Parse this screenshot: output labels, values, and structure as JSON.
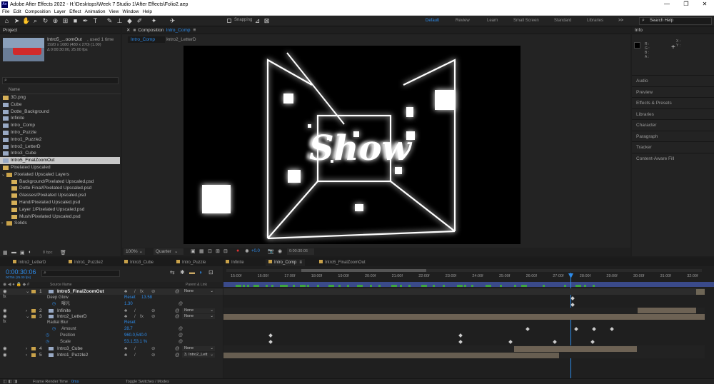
{
  "app": {
    "title": "Adobe After Effects 2022 - H:\\Desktops\\Week 7 Studio 1\\After Effects\\Folio2.aep",
    "icon_text": "Ae"
  },
  "menu": [
    "File",
    "Edit",
    "Composition",
    "Layer",
    "Effect",
    "Animation",
    "View",
    "Window",
    "Help"
  ],
  "toolbar": {
    "snapping_label": "Snapping",
    "search_placeholder": "Search Help",
    "more_label": ">>"
  },
  "workspaces": [
    "Default",
    "Review",
    "Learn",
    "Small Screen",
    "Standard",
    "Libraries"
  ],
  "project": {
    "tab": "Project",
    "selected_name": "Intro5_...oomOut",
    "selected_used": ", used 1 time",
    "selected_info1": "1920 x 1080 (480 x 270) (1.00)",
    "selected_info2": "Δ 0:00:30:00, 25.00 fps",
    "search_placeholder": "",
    "column_name": "Name",
    "items": [
      "3D.png",
      "Cube",
      "Dotte_Background",
      "Infinite",
      "Intro_Comp",
      "Intro_Puzzle",
      "Intro1_Puzzle2",
      "Intro2_LetterD",
      "Intro3_Cube",
      "Intro5_FinalZoomOut",
      "Pixelated Upscaled",
      "Pixelated Upscaled Layers",
      "Background/Pixelated Upscaled.psd",
      "Dotte Final/Pixelated Upscaled.psd",
      "Glasses/Pixelated Upscaled.psd",
      "Hand/Pixelated Upscaled.psd",
      "Layer 1/Pixelated Upscaled.psd",
      "Mush/Pixelated Upscaled.psd",
      "Solids"
    ],
    "bpc": "8 bpc"
  },
  "composition": {
    "tab_prefix": "Composition",
    "tab_name": "Intro_Comp",
    "menu_icon": "≡",
    "breadcrumbs": [
      "Intro_Comp",
      "Intro2_LetterD"
    ],
    "viewer_text": "Show",
    "zoom": "100%",
    "resolution": "Quarter",
    "exposure": "+0.0",
    "timecode": "0:00:30:06"
  },
  "right_panel": {
    "info_tab": "Info",
    "info_labels": [
      "R :",
      "G :",
      "B :",
      "A :"
    ],
    "info_xy": [
      "X :",
      "Y :"
    ],
    "items": [
      "Audio",
      "Preview",
      "Effects & Presets",
      "Libraries",
      "Character",
      "Paragraph",
      "Tracker",
      "Content-Aware Fill"
    ]
  },
  "timeline": {
    "tabs": [
      "Intro2_LetterD",
      "Intro1_Puzzle2",
      "Intro3_Cube",
      "Intro_Puzzle",
      "Infinite",
      "Intro_Comp",
      "Intro5_FinalZoomOut"
    ],
    "active_tab": "Intro_Comp",
    "timecode": "0:00:30:06",
    "timecode_sub": "00756 (25.00 fps)",
    "columns": {
      "source": "Source Name",
      "parent": "Parent & Link"
    },
    "ticks": [
      "15:00f",
      "16:00f",
      "17:00f",
      "18:00f",
      "19:00f",
      "20:00f",
      "21:00f",
      "22:00f",
      "23:00f",
      "24:00f",
      "25:00f",
      "26:00f",
      "27:00f",
      "28:00f",
      "29:00f",
      "30:00f",
      "31:00f",
      "32:00f",
      "33:00f",
      "34:00f",
      "35:00f",
      "36:00f"
    ],
    "layers": [
      {
        "num": "1",
        "name": "Intro5_FinalZoomOut",
        "parent": "None"
      },
      {
        "num": "2",
        "name": "Infinite",
        "parent": "None"
      },
      {
        "num": "3",
        "name": "Intro2_LetterD",
        "parent": "None"
      },
      {
        "num": "4",
        "name": "Intro3_Cube",
        "parent": "None"
      },
      {
        "num": "5",
        "name": "Intro1_Puzzle2",
        "parent": "3. Intro2_Lett"
      }
    ],
    "deep_glow": {
      "name": "Deep Glow",
      "reset": "Reset",
      "reset_val": "13.58",
      "sub": "曝光",
      "sub_val": "1.30"
    },
    "radial_blur": {
      "name": "Radial Blur",
      "reset": "Reset",
      "amount_label": "Amount",
      "amount": "28.7"
    },
    "position": {
      "label": "Position",
      "value": "960.0,540.0"
    },
    "scale": {
      "label": "Scale",
      "value": "53.1,53.1 %"
    },
    "footer": {
      "render_label": "Frame Render Time",
      "render_val": "0ms",
      "toggle": "Toggle Switches / Modes"
    }
  }
}
